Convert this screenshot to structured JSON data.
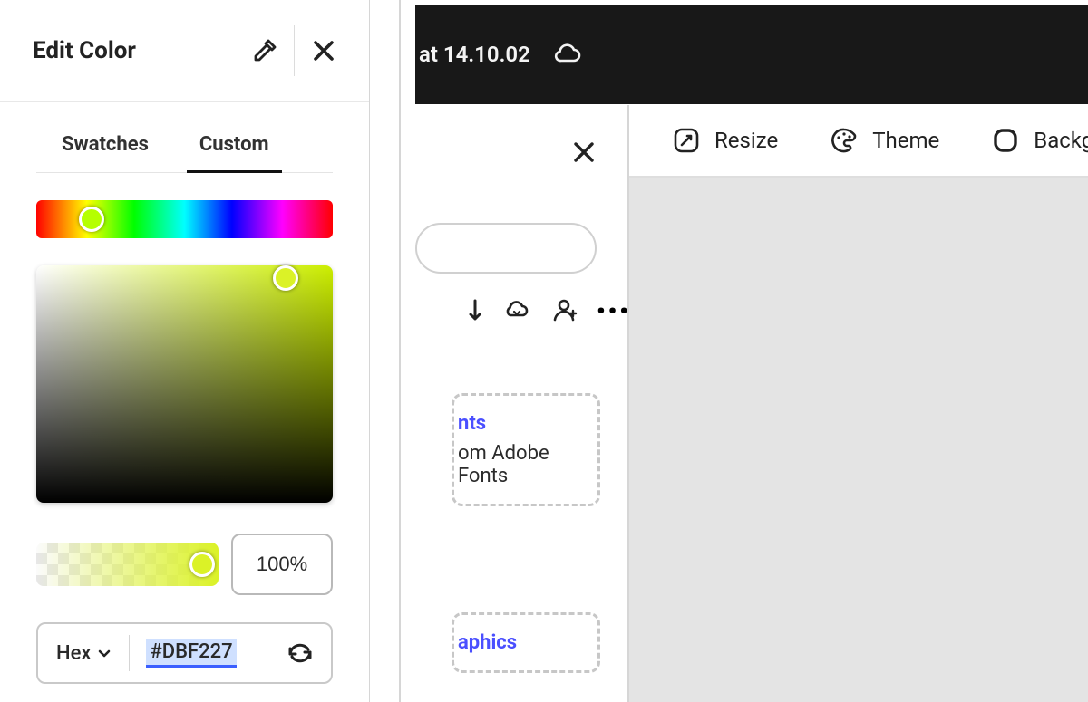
{
  "color_panel": {
    "title": "Edit Color",
    "tabs": {
      "swatches": "Swatches",
      "custom": "Custom"
    },
    "active_tab": "custom",
    "selected_color_hex": "#DBF227",
    "hue_handle_position_percent": 18.7,
    "sv_handle_position": {
      "x_percent": 84,
      "y_percent": 5.5
    },
    "opacity": {
      "percent": 100,
      "display": "100%"
    },
    "color_mode": {
      "label": "Hex"
    }
  },
  "document": {
    "title_fragment": "at 14.10.02"
  },
  "secondary_panel": {
    "fonts_card": {
      "link_fragment": "nts",
      "subtitle_fragment": "om Adobe Fonts"
    },
    "graphics_card": {
      "link_fragment": "aphics"
    }
  },
  "ribbon": {
    "resize": "Resize",
    "theme": "Theme",
    "background": "Backgro"
  }
}
